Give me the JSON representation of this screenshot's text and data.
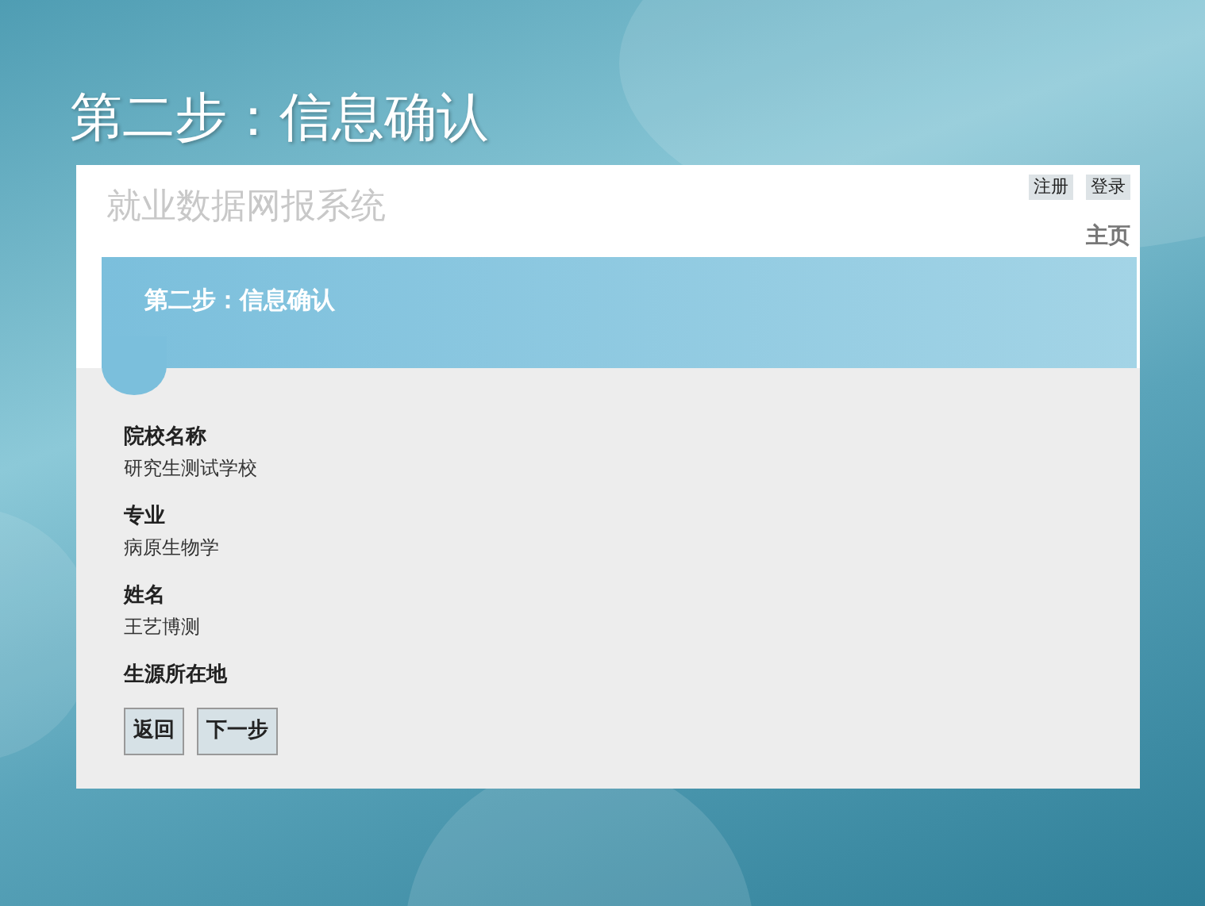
{
  "slide": {
    "title": "第二步：信息确认"
  },
  "site": {
    "title": "就业数据网报系统",
    "top_links": [
      "注册",
      "登录"
    ],
    "nav": [
      "主页"
    ]
  },
  "banner": {
    "title": "第二步：信息确认"
  },
  "fields": [
    {
      "label": "院校名称",
      "value": "研究生测试学校"
    },
    {
      "label": "专业",
      "value": "病原生物学"
    },
    {
      "label": "姓名",
      "value": "王艺博测"
    },
    {
      "label": "生源所在地"
    }
  ],
  "buttons": [
    "返回",
    "下一步"
  ]
}
